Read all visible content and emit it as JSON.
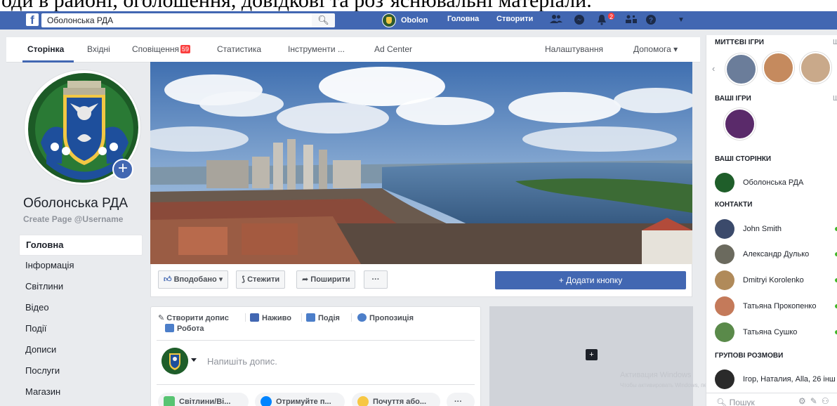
{
  "document_caption": "оди в районі, оголошення, довідкові та роз’яснювальні матеріали.",
  "topbar": {
    "logo": "f",
    "search_value": "Оболонська РДА",
    "profile_name": "Obolon",
    "home_label": "Головна",
    "create_label": "Створити",
    "notification_count": "2"
  },
  "tabs": {
    "items": [
      "Сторінка",
      "Вхідні",
      "Сповіщення",
      "Статистика",
      "Інструменти ...",
      "Ad Center"
    ],
    "notifications_badge": "59",
    "settings_label": "Налаштування",
    "help_label": "Допомога ▾"
  },
  "page": {
    "name": "Оболонська РДА",
    "username": "Create Page @Username"
  },
  "left_nav": [
    "Головна",
    "Інформація",
    "Світлини",
    "Відео",
    "Події",
    "Дописи",
    "Послуги",
    "Магазин"
  ],
  "actions": {
    "like_label": "Вподобано ▾",
    "follow_label": "Стежити",
    "share_label": "Поширити",
    "more_label": "···",
    "add_button_label": "+ Додати кнопку"
  },
  "composer": {
    "create_post": "Створити допис",
    "live": "Наживо",
    "event": "Подія",
    "offer": "Пропозиція",
    "job": "Робота",
    "placeholder": "Напишіть допис.",
    "pills": [
      "Світлини/Ві...",
      "Отримуйте п...",
      "Почуття або..."
    ],
    "pills_more": "···"
  },
  "right_sidebar": {
    "instant_games": "МИТТЄВІ ІГРИ",
    "your_games": "ВАШІ ІГРИ",
    "your_pages": "ВАШІ СТОРІНКИ",
    "page_item": "Оболонська РДА",
    "contacts": "КОНТАКТИ",
    "contact_list": [
      "John Smith",
      "Александр Дулько",
      "Dmitryi Korolenko",
      "Татьяна Прокопенко",
      "Татьяна Сушко"
    ],
    "group_chats": "ГРУПОВІ РОЗМОВИ",
    "group_chat_item": "Ігор, Наталия, Alla, 26 інш",
    "search_placeholder": "Пошук",
    "see_all": "Ш"
  },
  "watermark": {
    "line1": "Активация Windows",
    "line2": "Чтобы активировать Windows, перейдите в раздел \"Параметры\"."
  }
}
